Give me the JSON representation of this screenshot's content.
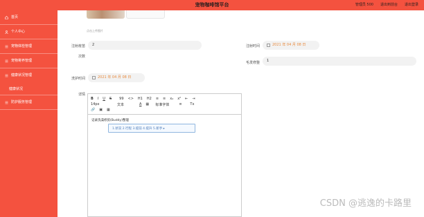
{
  "header": {
    "title": "宠物咖啡馆平台",
    "links": [
      "管理员 500",
      "退出到前台",
      "退出登录"
    ]
  },
  "sidebar": {
    "items": [
      {
        "label": "首页",
        "icon": "home-icon"
      },
      {
        "label": "个人中心",
        "icon": "user-icon"
      },
      {
        "label": "宠物体检管理",
        "icon": "list-icon"
      },
      {
        "label": "宠物寄养管理",
        "icon": "list-icon"
      },
      {
        "label": "健康状况管理",
        "icon": "list-icon"
      },
      {
        "label": "健康状况",
        "sub": true
      },
      {
        "label": "防护服务管理",
        "icon": "list-icon"
      }
    ]
  },
  "form": {
    "photo_hint": "点击上传图片",
    "register_number_label": "注射疫苗",
    "register_number_value": "2",
    "register_time_label": "注射时间",
    "register_time_value": "2021 年 04 月 08 日",
    "times_label": "次数",
    "coat_color_label": "毛发修整",
    "coat_color_value": "1",
    "inspect_time_label": "洗护时间",
    "inspect_time_value": "2021 年 04 月 08 日",
    "detail_label": "详情"
  },
  "editor": {
    "toolbar_row1": [
      "B",
      "I",
      "U",
      "S",
      "99",
      "<>",
      "H1",
      "H2",
      "≡",
      "≡",
      "x₂",
      "x²",
      "⇤",
      "⇥"
    ],
    "toolbar_row2": [
      "14px",
      "文本",
      "A",
      "标准字体",
      "≡",
      "Tx"
    ],
    "toolbar_row3": [
      "🔗",
      "▣",
      "▦"
    ],
    "body_text": "记录洗澡修剪(Buddy)整理",
    "dropdown_text": "1.状况 2.行程 3.提前 4.提升 5.新手 ▸"
  },
  "watermark": "CSDN @逃逸的卡路里"
}
